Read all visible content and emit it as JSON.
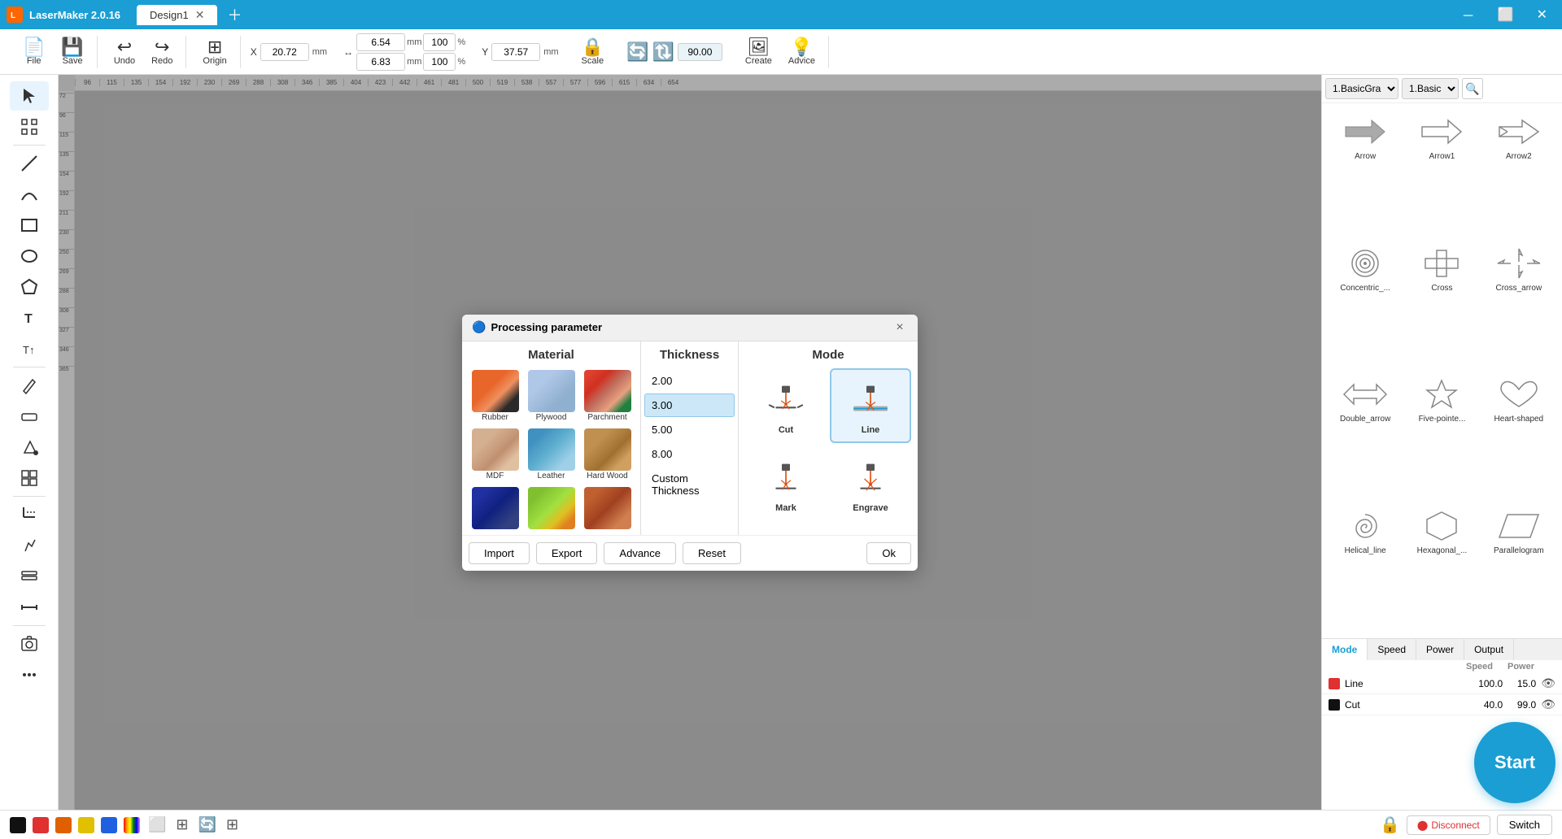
{
  "app": {
    "name": "LaserMaker 2.0.16",
    "tab": "Design1",
    "logo_text": "L"
  },
  "toolbar": {
    "file_label": "File",
    "save_label": "Save",
    "undo_label": "Undo",
    "redo_label": "Redo",
    "origin_label": "Origin",
    "scale_label": "Scale",
    "create_label": "Create",
    "advice_label": "Advice",
    "x_label": "X",
    "y_label": "Y",
    "x_value": "20.72",
    "y_value": "37.57",
    "w_value": "6.54",
    "h_value": "6.83",
    "w_pct": "100",
    "h_pct": "100",
    "angle_value": "90.00",
    "mm_unit": "mm",
    "pct_unit": "%"
  },
  "shape_panel": {
    "dropdown1": "1.BasicGra",
    "dropdown2": "1.Basic",
    "shapes": [
      {
        "name": "Arrow",
        "label": "Arrow"
      },
      {
        "name": "Arrow1",
        "label": "Arrow1"
      },
      {
        "name": "Arrow2",
        "label": "Arrow2"
      },
      {
        "name": "Concentric",
        "label": "Concentric_..."
      },
      {
        "name": "Cross",
        "label": "Cross"
      },
      {
        "name": "Cross_arrow",
        "label": "Cross_arrow"
      },
      {
        "name": "Double_arrow",
        "label": "Double_arrow"
      },
      {
        "name": "Five_pointed",
        "label": "Five-pointe..."
      },
      {
        "name": "Heart_shaped",
        "label": "Heart-shaped"
      },
      {
        "name": "Helical_line",
        "label": "Helical_line"
      },
      {
        "name": "Hexagonal",
        "label": "Hexagonal_..."
      },
      {
        "name": "Parallelogram",
        "label": "Parallelogram"
      }
    ]
  },
  "layers": {
    "tab_mode": "Mode",
    "tab_speed": "Speed",
    "tab_power": "Power",
    "tab_output": "Output",
    "rows": [
      {
        "color": "#e03030",
        "name": "Line",
        "speed": "100.0",
        "power": "15.0"
      },
      {
        "color": "#111111",
        "name": "Cut",
        "speed": "40.0",
        "power": "99.0"
      }
    ]
  },
  "start_btn": "Start",
  "bottom": {
    "disconnect_label": "Disconnect",
    "switch_label": "Switch"
  },
  "modal": {
    "title": "Processing parameter",
    "close_label": "×",
    "section_material": "Material",
    "section_thickness": "Thickness",
    "section_mode": "Mode",
    "materials": [
      {
        "key": "rubber",
        "label": "Rubber"
      },
      {
        "key": "plywood",
        "label": "Plywood"
      },
      {
        "key": "parchment",
        "label": "Parchment"
      },
      {
        "key": "mdf",
        "label": "MDF"
      },
      {
        "key": "leather",
        "label": "Leather"
      },
      {
        "key": "hardwood",
        "label": "Hard Wood"
      },
      {
        "key": "fabric1",
        "label": ""
      },
      {
        "key": "fabric2",
        "label": ""
      },
      {
        "key": "fabric3",
        "label": ""
      }
    ],
    "thicknesses": [
      {
        "value": "2.00",
        "selected": false
      },
      {
        "value": "3.00",
        "selected": true
      },
      {
        "value": "5.00",
        "selected": false
      },
      {
        "value": "8.00",
        "selected": false
      },
      {
        "value": "Custom Thickness",
        "selected": false
      }
    ],
    "modes": [
      {
        "key": "cut",
        "label": "Cut",
        "selected": false
      },
      {
        "key": "line",
        "label": "Line",
        "selected": true
      },
      {
        "key": "mark",
        "label": "Mark",
        "selected": false
      },
      {
        "key": "engrave",
        "label": "Engrave",
        "selected": false
      }
    ],
    "buttons": [
      {
        "key": "import",
        "label": "Import"
      },
      {
        "key": "export",
        "label": "Export"
      },
      {
        "key": "advance",
        "label": "Advance"
      },
      {
        "key": "reset",
        "label": "Reset"
      },
      {
        "key": "ok",
        "label": "Ok"
      }
    ]
  }
}
